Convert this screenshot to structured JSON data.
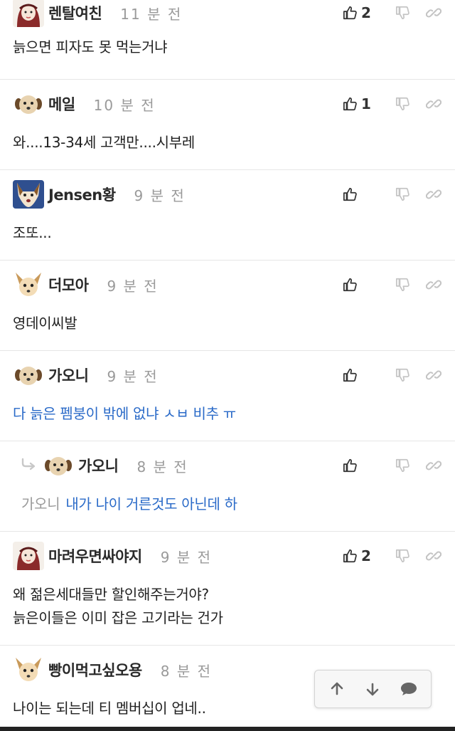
{
  "comments": [
    {
      "nickname": "렌탈여친",
      "time": "11 분 전",
      "likes": "2",
      "body": [
        "늙으면 피자도 못 먹는거냐"
      ],
      "avatar": "girl-avatar"
    },
    {
      "nickname": "메일",
      "time": "10 분 전",
      "likes": "1",
      "body": [
        "와....13-34세 고객만....시부레"
      ],
      "avatar": "dog-avatar"
    },
    {
      "nickname": "Jensen황",
      "time": "9 분 전",
      "likes": "",
      "body": [
        "조또..."
      ],
      "avatar": "wolf-avatar"
    },
    {
      "nickname": "더모아",
      "time": "9 분 전",
      "likes": "",
      "body": [
        "영데이씨발"
      ],
      "avatar": "chihuahua-avatar"
    },
    {
      "nickname": "가오니",
      "time": "9 분 전",
      "likes": "",
      "body": [
        "다 늙은 펨붕이 밖에 없냐 ㅅㅂ 비추 ㅠ"
      ],
      "avatar": "dog-avatar"
    },
    {
      "nickname": "가오니",
      "time": "8 분 전",
      "likes": "",
      "mention": "가오니",
      "body": [
        "내가 나이 거른것도 아닌데 하"
      ],
      "avatar": "dog-avatar"
    },
    {
      "nickname": "마려우면싸야지",
      "time": "9 분 전",
      "likes": "2",
      "body": [
        "왜 젊은세대들만 할인해주는거야?",
        "늙은이들은 이미 잡은 고기라는 건가"
      ],
      "avatar": "girl-avatar"
    },
    {
      "nickname": "빵이먹고싶오용",
      "time": "8 분 전",
      "likes": "",
      "body": [
        "나이는 되는데 티 멤버십이 업네.."
      ],
      "avatar": "chihuahua-avatar"
    }
  ],
  "icons": {
    "like": "thumbs-up-icon",
    "dislike": "thumbs-down-icon",
    "share": "link-icon",
    "reply": "reply-arrow-icon",
    "scroll_up": "arrow-up-icon",
    "scroll_down": "arrow-down-icon",
    "chat": "speech-bubble-icon"
  },
  "colors": {
    "reply_text": "#2a6ac8",
    "time": "#9a9a9a",
    "divider": "#e6e6e6"
  }
}
